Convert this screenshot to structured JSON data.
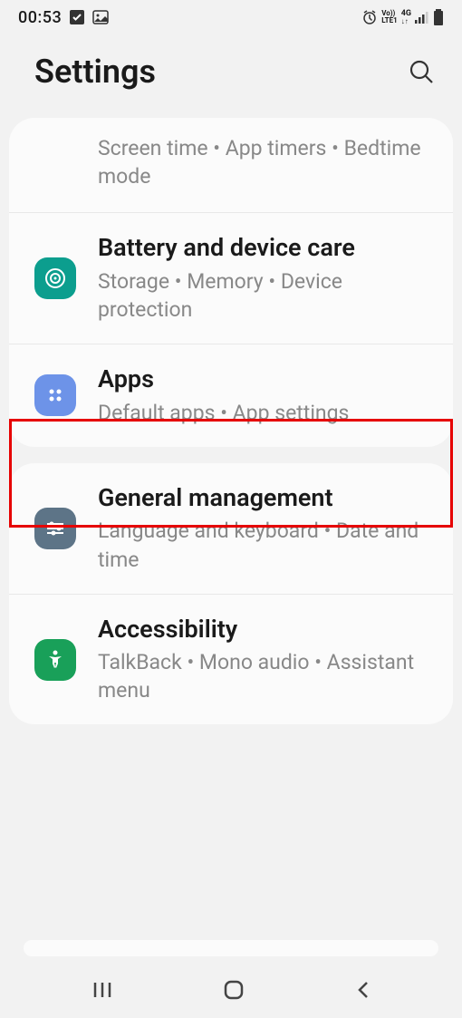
{
  "status": {
    "time": "00:53"
  },
  "header": {
    "title": "Settings"
  },
  "group1": {
    "item0": {
      "subtitle": "Screen time  •  App timers  •  Bedtime mode"
    },
    "item1": {
      "title": "Battery and device care",
      "subtitle": "Storage  •  Memory  •  Device protection"
    },
    "item2": {
      "title": "Apps",
      "subtitle": "Default apps  •  App settings"
    }
  },
  "group2": {
    "item0": {
      "title": "General management",
      "subtitle": "Language and keyboard  •  Date and time"
    },
    "item1": {
      "title": "Accessibility",
      "subtitle": "TalkBack  •  Mono audio  •  Assistant menu"
    }
  }
}
